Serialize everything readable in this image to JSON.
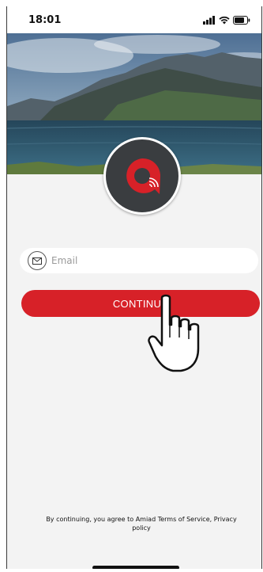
{
  "status_bar": {
    "time": "18:01"
  },
  "email": {
    "placeholder": "Email",
    "value": ""
  },
  "continue_label": "CONTINUE",
  "terms_text": "By continuing, you agree to Amiad Terms of Service, Privacy policy",
  "icons": [
    "signal-icon",
    "wifi-icon",
    "battery-icon",
    "envelope-icon",
    "app-logo-icon",
    "hand-pointer-icon"
  ],
  "colors": {
    "brand_red": "#d72128",
    "logo_bg": "#3a3d40",
    "background": "#f3f3f3"
  }
}
